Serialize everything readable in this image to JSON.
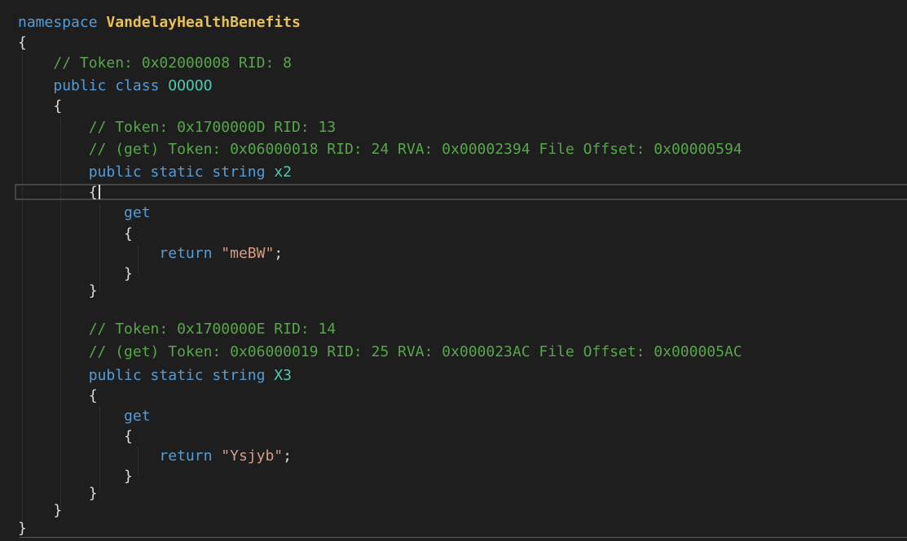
{
  "editor": {
    "namespace_keyword": "namespace",
    "namespace_name": "VandelayHealthBenefits",
    "class": {
      "token_comment": "// Token: 0x02000008 RID: 8",
      "modifiers": "public class",
      "name": "OOOOO"
    },
    "properties": [
      {
        "token_comment": "// Token: 0x1700000D RID: 13",
        "getter_comment": "// (get) Token: 0x06000018 RID: 24 RVA: 0x00002394 File Offset: 0x00000594",
        "modifiers": "public static string",
        "name": "x2",
        "accessor": "get",
        "return_keyword": "return",
        "return_value": "\"meBW\""
      },
      {
        "token_comment": "// Token: 0x1700000E RID: 14",
        "getter_comment": "// (get) Token: 0x06000019 RID: 25 RVA: 0x000023AC File Offset: 0x000005AC",
        "modifiers": "public static string",
        "name": "X3",
        "accessor": "get",
        "return_keyword": "return",
        "return_value": "\"Ysjyb\""
      }
    ],
    "open_brace": "{",
    "close_brace": "}",
    "semicolon": ";"
  },
  "colors": {
    "background": "#1e1e1e",
    "keyword": "#569cd6",
    "namespace": "#e6c15a",
    "type": "#4ec9b0",
    "comment": "#57a64a",
    "string": "#d69d85",
    "punctuation": "#dcdcdc"
  }
}
